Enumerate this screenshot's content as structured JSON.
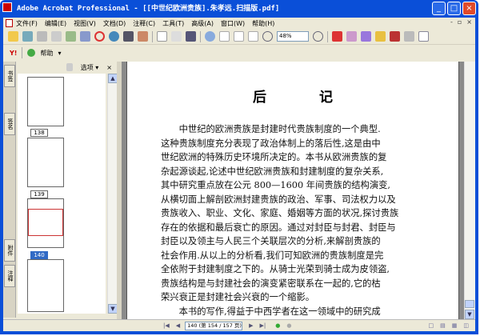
{
  "window": {
    "title": "Adobe Acrobat Professional - [[中世纪欧洲贵族].朱孝远.扫描版.pdf]"
  },
  "menu": [
    "文件(F)",
    "编辑(E)",
    "视图(V)",
    "文档(D)",
    "注释(C)",
    "工具(T)",
    "高级(A)",
    "窗口(W)",
    "帮助(H)"
  ],
  "toolbar": {
    "zoom_value": "48%"
  },
  "toolbar2": {
    "help_label": "帮助"
  },
  "sidebar": {
    "tabs": [
      "书签",
      "签名",
      "附件",
      "注释"
    ],
    "options_label": "选项",
    "close": "×",
    "thumbnails": [
      {
        "label": "138"
      },
      {
        "label": "139"
      },
      {
        "label": "140",
        "selected": true
      }
    ]
  },
  "document": {
    "title": "后 记",
    "paragraphs": [
      "　　中世纪的欧洲贵族是封建时代贵族制度的一个典型.",
      "这种贵族制度充分表现了政治体制上的落后性,这是由中",
      "世纪欧洲的特殊历史环境所决定的。本书从欧洲贵族的复",
      "杂起源谈起,论述中世纪欧洲贵族和封建制度的复杂关系,",
      "其中研究重点放在公元 800—1600 年间贵族的结构演变,",
      "从横切面上解剖欧洲封建贵族的政治、军事、司法权力以及",
      "贵族收入、职业、文化、家庭、婚姻等方面的状况,探讨贵族",
      "存在的依据和最后衰亡的原因。通过对封臣与封君、封臣与",
      "封臣以及领主与人民三个关联层次的分析,来解剖贵族的",
      "社会作用.从以上的分析看,我们可知欧洲的贵族制度是完",
      "全依附于封建制度之下的。从骑士光荣到骑士成为皮领盗,",
      "贵族结构是与封建社会的演变紧密联系在一起的,它的枯",
      "荣兴衰正是封建社会兴衰的一个缩影。",
      "　　本书的写作,得益于中西学者在这一领域中的研究成"
    ]
  },
  "status": {
    "page_box": "140 (第 154 / 157 页)"
  }
}
